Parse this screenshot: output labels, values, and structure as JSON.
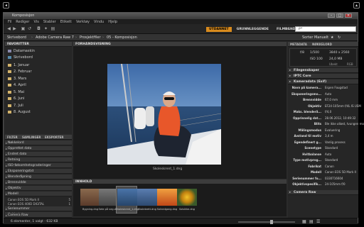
{
  "window": {
    "title": "Komposisjon"
  },
  "menu": [
    "Fil",
    "Rediger",
    "Vis",
    "Stabler",
    "Etikett",
    "Verktøy",
    "Vindu",
    "Hjelp"
  ],
  "workspaces": {
    "active": "UTDANNET",
    "items": [
      "GRUNNLEGGENDE",
      "FILMBÅND"
    ]
  },
  "search": {
    "placeholder": "ρ•"
  },
  "path": [
    "Skrivebord",
    "Adobe Camera Raw 7",
    "Prosjektfiler",
    "05 - Komposisjon"
  ],
  "path_right": "Sorter Manuelt",
  "favorites": {
    "header": "FAVORITTER",
    "items": [
      "Datamaskin",
      "Skrivebord",
      "1. Januar",
      "2. Februar",
      "3. Mars",
      "4. April",
      "5. Mai",
      "6. Juni",
      "7. Juli",
      "8. August"
    ]
  },
  "filter_tabs": [
    "FILTER",
    "SAMLINGER",
    "EKSPORTER"
  ],
  "filters": [
    "Nøkkelord",
    "Opprettet dato",
    "Endret dato",
    "Retning",
    "ISO-følsomhetsgraderinger",
    "Eksponeringstid",
    "Blenderåpning",
    "Brennvidde",
    "Objektiv",
    "Modell"
  ],
  "models": [
    {
      "name": "Canon EOS 5D Mark II",
      "count": "5"
    },
    {
      "name": "Canon EOS 400D DIGITAL",
      "count": "1"
    }
  ],
  "filters_after": [
    "Serienummer",
    "Hvitbalanse",
    "Camera Raw"
  ],
  "preview": {
    "header": "FORHÅNDSVISNING",
    "caption": "Skoleskrent_1.dng"
  },
  "filmstrip": {
    "header": "INNHOLD",
    "items": [
      "Bygning.dng",
      "Sete på veg.dng",
      "Skoleskrent_1.dng",
      "Skolebrett.dng",
      "Solnedgang.dng",
      "Solsikke.dng"
    ]
  },
  "right_tabs": [
    "METADATA",
    "NØKKELORD"
  ],
  "info": {
    "aperture": "f/8",
    "shutter": "1/500",
    "iso": "ISO 100",
    "size": "3840 x 2560",
    "size2": "24,0 MB",
    "unit": "Ubekt",
    "mode": "RGB"
  },
  "file_props": "Filegenskaper",
  "iptc": "IPTC Core",
  "camera_data_header": "Kameradata (Exif)",
  "camera_data": [
    {
      "k": "Navn på kamera...",
      "v": "Espen Fougstad"
    },
    {
      "k": "Eksponeringsmo...",
      "v": "Auto"
    },
    {
      "k": "Brennvidde",
      "v": "67,0 mm"
    },
    {
      "k": "Objektiv",
      "v": "EF24-105mm f/4L IS USM"
    },
    {
      "k": "Maks. blenderå...",
      "v": "f/4,0"
    },
    {
      "k": "Opprinnelig dat...",
      "v": "28.06.2012, 10:49:32"
    },
    {
      "k": "Blits",
      "v": "Ble ikke utløst, tvungen modus"
    },
    {
      "k": "Målingsmodus",
      "v": "Evaluering"
    },
    {
      "k": "Avstand til motiv",
      "v": "3,4 m"
    },
    {
      "k": "Egendefinert g...",
      "v": "Vanlig prosess"
    },
    {
      "k": "Scenetype",
      "v": "Standard"
    },
    {
      "k": "Hvitbalanse",
      "v": "Auto"
    },
    {
      "k": "Type motivprog...",
      "v": "Standard"
    },
    {
      "k": "Fabrikat",
      "v": "Canon"
    },
    {
      "k": "Modell",
      "v": "Canon EOS 5D Mark II"
    },
    {
      "k": "Serienummer fo...",
      "v": "0330716604"
    },
    {
      "k": "Objektivspesifik...",
      "v": "24-105mm f/0"
    }
  ],
  "camera_raw": "Camera Raw",
  "status": {
    "text": "6 elementer, 1 valgt - 632 KB"
  }
}
